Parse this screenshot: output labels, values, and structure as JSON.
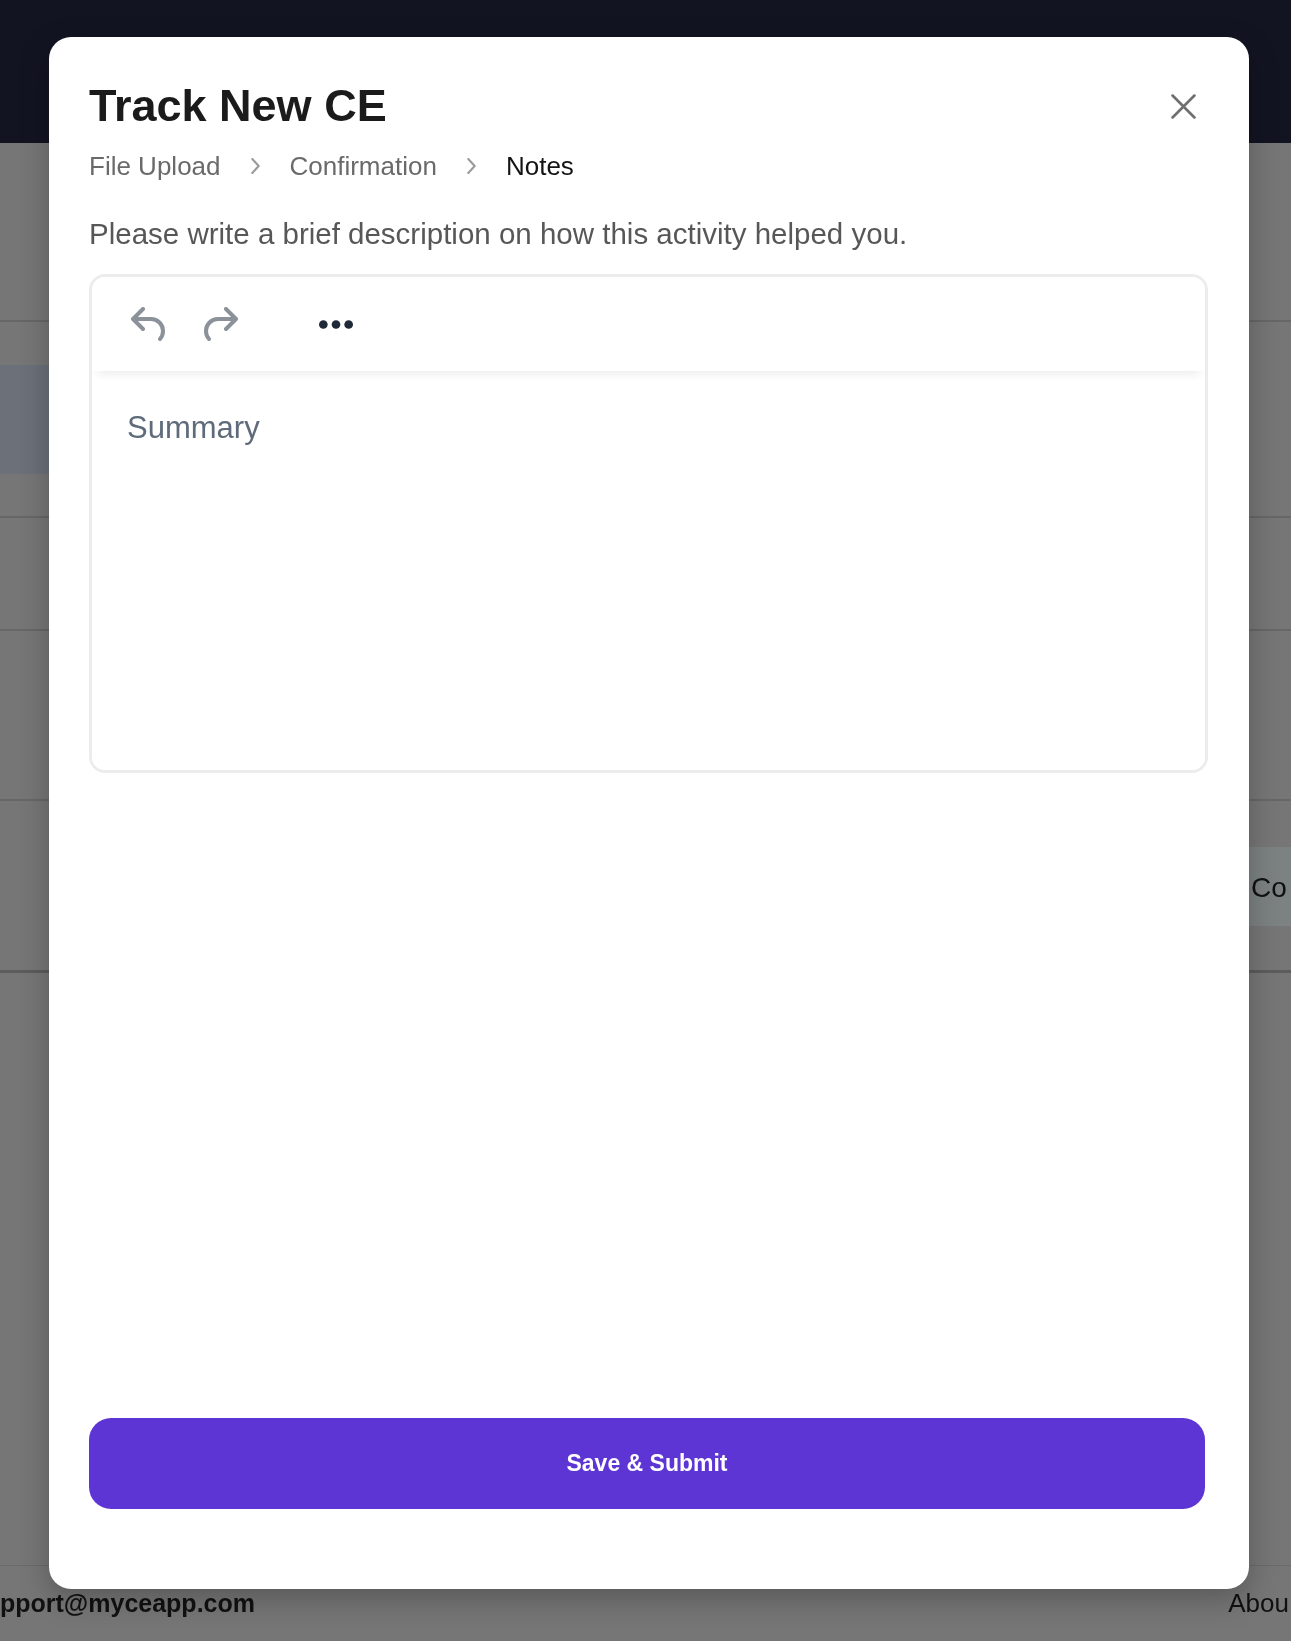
{
  "background_page": {
    "button_label": "Co",
    "footer_email": "pport@myceapp.com",
    "footer_link": "Abou"
  },
  "dialog": {
    "title": "Track New CE",
    "steps": [
      {
        "label": "File Upload",
        "selected": false
      },
      {
        "label": "Confirmation",
        "selected": false
      },
      {
        "label": "Notes",
        "selected": true
      }
    ],
    "instruction": "Please write a brief description on how this activity helped you.",
    "editor": {
      "toolbar": [
        {
          "kind": "undo",
          "disabled": true
        },
        {
          "kind": "redo",
          "disabled": true
        },
        {
          "kind": "more",
          "disabled": false
        }
      ],
      "placeholder": "Summary"
    },
    "submit_button": "Save & Submit"
  }
}
